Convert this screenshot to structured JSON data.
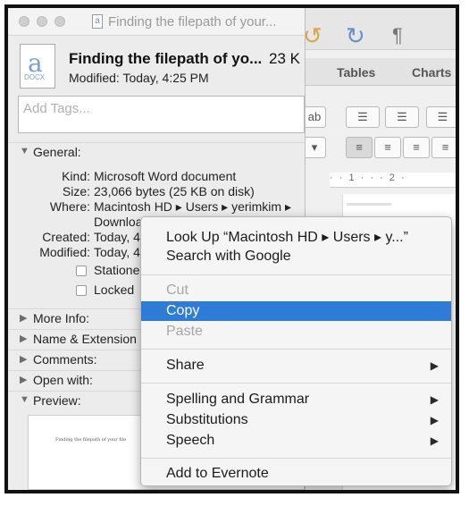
{
  "info_window": {
    "title": "Finding the filepath of your...",
    "file_name": "Finding the filepath of yo...",
    "file_size_head": "23 K",
    "modified_head": "Modified: Today, 4:25 PM",
    "tags_placeholder": "Add Tags...",
    "general": {
      "header": "General:",
      "kind_label": "Kind:",
      "kind": "Microsoft Word document",
      "size_label": "Size:",
      "size": "23,066 bytes (25 KB on disk)",
      "where_label": "Where:",
      "where_line1": "Macintosh HD ▸ Users ▸ yerimkim ▸",
      "where_line2": "Downloads ▸ D...",
      "created_label": "Created:",
      "created": "Today, 4:",
      "modified_label": "Modified:",
      "modified": "Today, 4:",
      "stationery_label": "Stationer",
      "locked_label": "Locked"
    },
    "sections": [
      "More Info:",
      "Name & Extension",
      "Comments:",
      "Open with:",
      "Preview:"
    ],
    "preview_text": "Finding the filepath of your file"
  },
  "word_window": {
    "tab_tables": "Tables",
    "tab_charts": "Charts",
    "pilcrow": "¶",
    "ruler": "· · 1 · · · 2 ·"
  },
  "context_menu": {
    "items": [
      {
        "label": "Look Up “Macintosh HD ▸ Users ▸ y...”",
        "state": "enabled"
      },
      {
        "label": "Search with Google",
        "state": "enabled"
      },
      {
        "label": "Cut",
        "state": "disabled"
      },
      {
        "label": "Copy",
        "state": "selected"
      },
      {
        "label": "Paste",
        "state": "disabled"
      },
      {
        "label": "Share",
        "state": "enabled",
        "submenu": true
      },
      {
        "label": "Spelling and Grammar",
        "state": "enabled",
        "submenu": true
      },
      {
        "label": "Substitutions",
        "state": "enabled",
        "submenu": true
      },
      {
        "label": "Speech",
        "state": "enabled",
        "submenu": true
      },
      {
        "label": "Add to Evernote",
        "state": "enabled"
      }
    ]
  },
  "colors": {
    "selection": "#2e7bd8",
    "window_bg": "#ececec",
    "disabled_text": "#a6a6a6"
  }
}
